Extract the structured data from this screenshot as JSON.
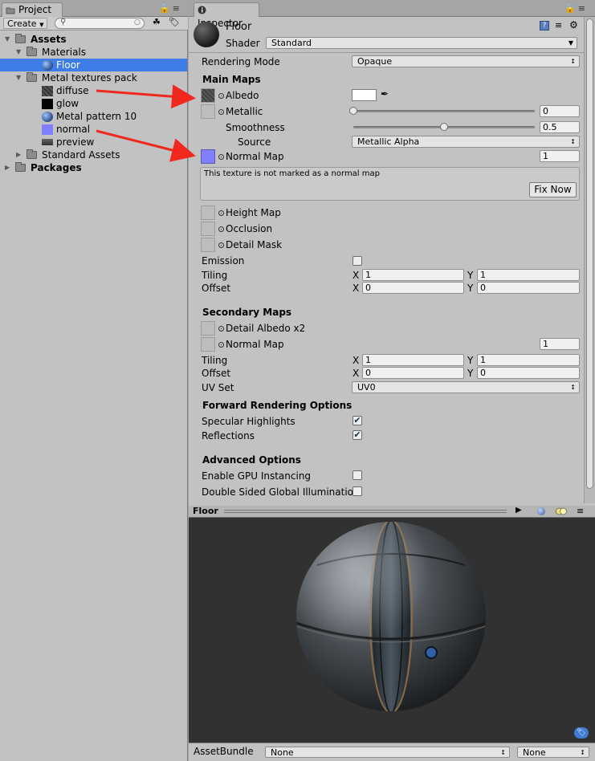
{
  "project": {
    "tab_title": "Project",
    "create_label": "Create",
    "search": {
      "value": "",
      "placeholder": ""
    },
    "tree": [
      {
        "label": "Assets",
        "bold": true,
        "indent": 0,
        "open": true,
        "kind": "folder"
      },
      {
        "label": "Materials",
        "indent": 1,
        "open": true,
        "kind": "folder"
      },
      {
        "label": "Floor",
        "indent": 2,
        "kind": "material",
        "selected": true
      },
      {
        "label": "Metal textures pack",
        "indent": 1,
        "open": true,
        "kind": "folder"
      },
      {
        "label": "diffuse",
        "indent": 2,
        "kind": "texture-dark"
      },
      {
        "label": "glow",
        "indent": 2,
        "kind": "texture-black"
      },
      {
        "label": "Metal pattern 10",
        "indent": 2,
        "kind": "material"
      },
      {
        "label": "normal",
        "indent": 2,
        "kind": "texture-normal"
      },
      {
        "label": "preview",
        "indent": 2,
        "kind": "texture-preview"
      },
      {
        "label": "Standard Assets",
        "indent": 1,
        "open": false,
        "kind": "folder"
      },
      {
        "label": "Packages",
        "bold": true,
        "indent": 0,
        "open": false,
        "kind": "folder"
      }
    ]
  },
  "inspector": {
    "tab_title": "Inspector",
    "material_name": "Floor",
    "shader_label": "Shader",
    "shader_value": "Standard",
    "rendering_mode_label": "Rendering Mode",
    "rendering_mode_value": "Opaque",
    "main_maps_header": "Main Maps",
    "albedo_label": "Albedo",
    "metallic_label": "Metallic",
    "metallic_value": "0",
    "metallic_fraction": 0,
    "smoothness_label": "Smoothness",
    "smoothness_value": "0.5",
    "smoothness_fraction": 0.5,
    "source_label": "Source",
    "source_value": "Metallic Alpha",
    "normal_map_label": "Normal Map",
    "normal_map_scale": "1",
    "warning_text": "This texture is not marked as a normal map",
    "fix_now_label": "Fix Now",
    "height_map_label": "Height Map",
    "occlusion_label": "Occlusion",
    "detail_mask_label": "Detail Mask",
    "emission_label": "Emission",
    "emission_checked": false,
    "tiling_label": "Tiling",
    "offset_label": "Offset",
    "x_label": "X",
    "y_label": "Y",
    "main_tiling_x": "1",
    "main_tiling_y": "1",
    "main_offset_x": "0",
    "main_offset_y": "0",
    "secondary_maps_header": "Secondary Maps",
    "detail_albedo_label": "Detail Albedo x2",
    "secondary_normal_label": "Normal Map",
    "secondary_normal_scale": "1",
    "sec_tiling_x": "1",
    "sec_tiling_y": "1",
    "sec_offset_x": "0",
    "sec_offset_y": "0",
    "uv_set_label": "UV Set",
    "uv_set_value": "UV0",
    "forward_header": "Forward Rendering Options",
    "specular_label": "Specular Highlights",
    "specular_checked": true,
    "reflections_label": "Reflections",
    "reflections_checked": true,
    "advanced_header": "Advanced Options",
    "gpu_instancing_label": "Enable GPU Instancing",
    "gpu_instancing_checked": false,
    "double_sided_label": "Double Sided Global Illumination",
    "double_sided_checked": false
  },
  "preview": {
    "title": "Floor",
    "assetbundle_label": "AssetBundle",
    "assetbundle_value": "None",
    "variant_value": "None"
  },
  "colors": {
    "selection": "#3e7de7",
    "panel_bg": "#c2c2c2",
    "preview_bg": "#313131",
    "annotation_arrow": "#f0281e",
    "normal_map_swatch": "#8080ff"
  }
}
